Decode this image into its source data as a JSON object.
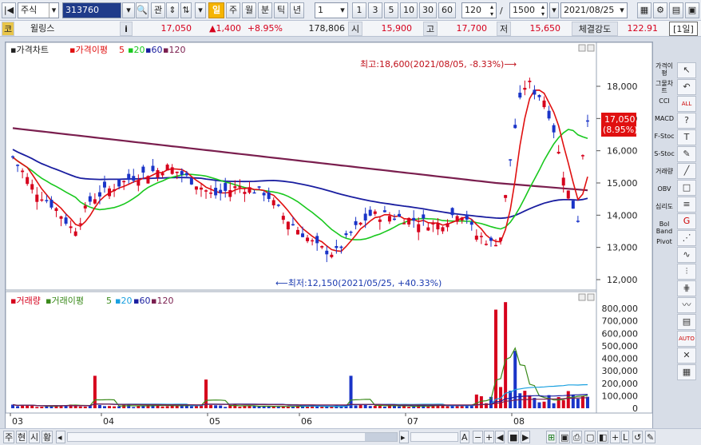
{
  "toolbar": {
    "market": "주식",
    "code": "313760",
    "btn_gwan": "관",
    "period_active": "일",
    "periods": [
      "주",
      "월",
      "분",
      "틱",
      "년"
    ],
    "interval_value": "1",
    "quick_intervals": [
      "1",
      "3",
      "5",
      "10",
      "30",
      "60"
    ],
    "count_value": "120",
    "count_sep": "/",
    "total_value": "1500",
    "date_value": "2021/08/25"
  },
  "quote": {
    "mark": "코",
    "name": "윌링스",
    "info_icon": "i",
    "price": "17,050",
    "change": "▲1,400",
    "change_pct": "+8.95%",
    "volume": "178,806",
    "open_label": "시",
    "open": "15,900",
    "high_label": "고",
    "high": "17,700",
    "low_label": "저",
    "low": "15,650",
    "strength_label": "체결강도",
    "strength": "122.91",
    "period_label": "[1일]"
  },
  "price_panel": {
    "legend_title": "가격차트",
    "legend_ma": "가격이평",
    "legend_periods": [
      "5",
      "20",
      "60",
      "120"
    ],
    "colors": {
      "up": "#d6001c",
      "down": "#1a34c8",
      "ma5": "#e01010",
      "ma20": "#19c81e",
      "ma60": "#1a1ea0",
      "ma120": "#7a1e4e"
    },
    "max_annotation": "최고:18,600(2021/08/05, -8.33%)⟶",
    "min_annotation": "⟵최저:12,150(2021/05/25, +40.33%)",
    "current_price_label": "17,050",
    "current_pct_label": "(8.95%)",
    "y_ticks": [
      "18,000",
      "17,000",
      "16,000",
      "15,000",
      "14,000",
      "13,000",
      "12,000"
    ]
  },
  "volume_panel": {
    "legend_title": "거래량",
    "legend_ma": "거래이평",
    "legend_periods": [
      "5",
      "20",
      "60",
      "120"
    ],
    "y_ticks": [
      "800,000",
      "700,000",
      "600,000",
      "500,000",
      "400,000",
      "300,000",
      "200,000",
      "100,000",
      "0"
    ]
  },
  "x_ticks": [
    "03",
    "04",
    "05",
    "06",
    "07",
    "08"
  ],
  "right_tools": [
    "가격이평",
    "그물차트",
    "CCI",
    "MACD",
    "F-Stoc",
    "S-Stoc",
    "거래량",
    "OBV",
    "심리도",
    "Bol Band",
    "Pivot"
  ],
  "right_icons": [
    "cursor-icon",
    "undo-icon",
    "all-icon",
    "help-icon",
    "text-icon",
    "pencil-icon",
    "line-icon",
    "rect-icon",
    "parallel-icon",
    "fib-icon",
    "fan-icon",
    "wave-icon",
    "bars-icon",
    "grid-icon",
    "zigzag-icon",
    "color-icon",
    "auto-icon",
    "delete-icon",
    "box-icon"
  ],
  "bottom_tabs": [
    "주",
    "현",
    "시",
    "황"
  ],
  "bottom_tools": [
    "A",
    "−",
    "+",
    "◀",
    "■",
    "▶"
  ]
}
